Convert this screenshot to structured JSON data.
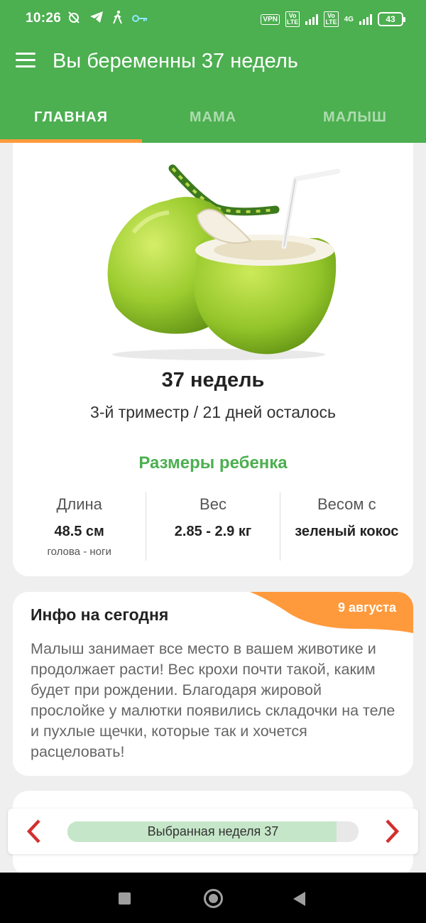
{
  "status_bar": {
    "time": "10:26",
    "left_icons": [
      "muted-alarm-icon",
      "telegram-icon",
      "walking-icon",
      "key-icon"
    ],
    "vpn": "VPN",
    "volte": "Vo LTE",
    "network": "4G",
    "battery": "43"
  },
  "app_bar": {
    "title": "Вы беременны 37 недель"
  },
  "tabs": [
    {
      "label": "ГЛАВНАЯ",
      "active": true
    },
    {
      "label": "МАМА",
      "active": false
    },
    {
      "label": "МАЛЫШ",
      "active": false
    }
  ],
  "week_card": {
    "image": "green-coconut",
    "weeks": "37 недель",
    "trimester": "3-й триместр / 21 дней осталось",
    "sizes_title": "Размеры ребенка",
    "stats": [
      {
        "label": "Длина",
        "value": "48.5 см",
        "sub": "голова - ноги"
      },
      {
        "label": "Вес",
        "value": "2.85 - 2.9 кг",
        "sub": ""
      },
      {
        "label": "Весом с",
        "value": "зеленый кокос",
        "sub": ""
      }
    ]
  },
  "info_card": {
    "title": "Инфо на сегодня",
    "date": "9 августа",
    "body": "Малыш занимает все место в вашем животике и продолжает расти! Вес крохи почти такой, каким будет при рождении. Благодаря жировой прослойке у малютки появились складочки на теле и пухлые щечки, которые так и хочется расцеловать!"
  },
  "week_selector": {
    "label": "Выбранная неделя 37",
    "progress": 0.925
  },
  "colors": {
    "primary": "#4caf50",
    "accent": "#ff9a3c",
    "arrow": "#d32f2f"
  }
}
